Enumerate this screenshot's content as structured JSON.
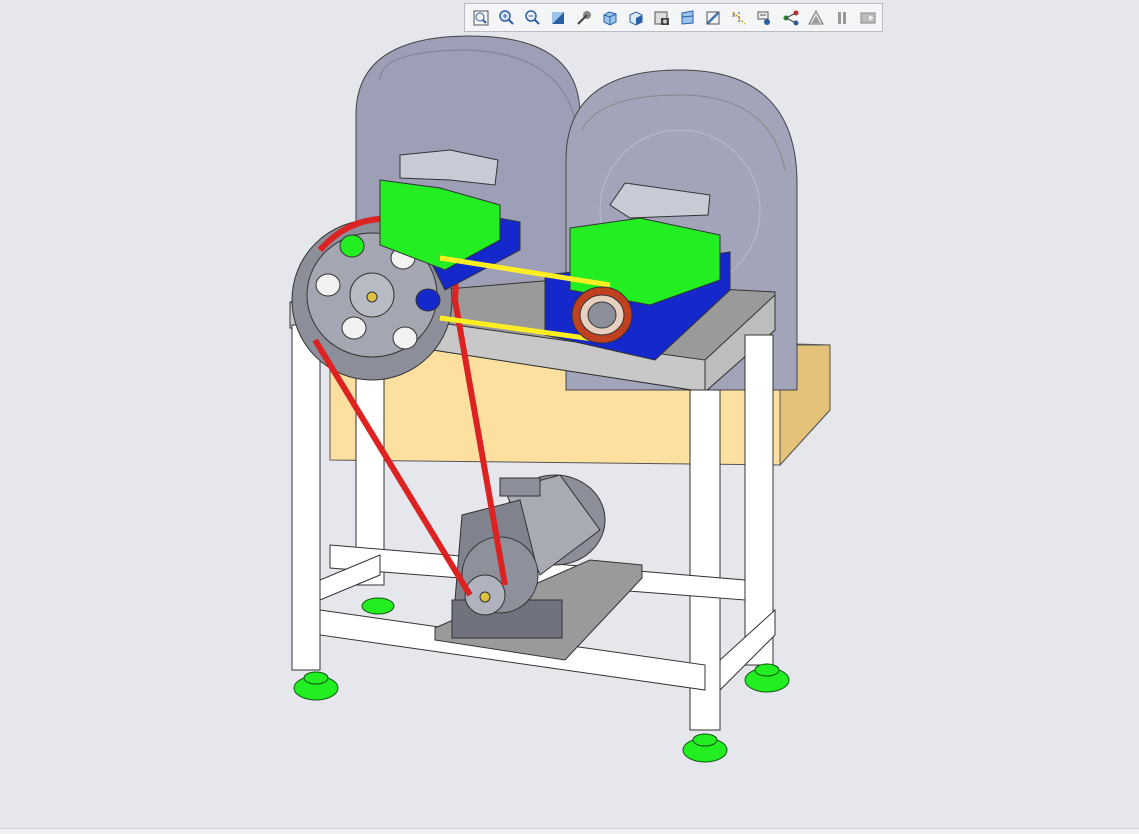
{
  "toolbar": {
    "tools": [
      {
        "name": "zoom-to-fit-icon"
      },
      {
        "name": "zoom-in-icon"
      },
      {
        "name": "zoom-out-icon"
      },
      {
        "name": "repaint-icon"
      },
      {
        "name": "spin-center-icon"
      },
      {
        "name": "saved-orientations-icon"
      },
      {
        "name": "display-style-icon"
      },
      {
        "name": "view-manager-icon"
      },
      {
        "name": "perspective-view-icon"
      },
      {
        "name": "section-icon"
      },
      {
        "name": "datum-display-icon"
      },
      {
        "name": "annotation-display-icon"
      },
      {
        "name": "connections-icon"
      },
      {
        "name": "appearance-icon"
      },
      {
        "name": "pause-icon"
      },
      {
        "name": "animation-icon"
      }
    ]
  },
  "colors": {
    "viewport_bg": "#e6e7ec",
    "frame_white": "#ffffff",
    "guard_gray": "#9c9fb6",
    "bearing_green": "#22ee22",
    "base_blue": "#1428cc",
    "belt_red": "#dd2222",
    "belt_yellow": "#ffee22",
    "table_top_gray": "#9a9a9a",
    "wood_tan": "#fde0a0",
    "motor_gray": "#8c8e99"
  }
}
